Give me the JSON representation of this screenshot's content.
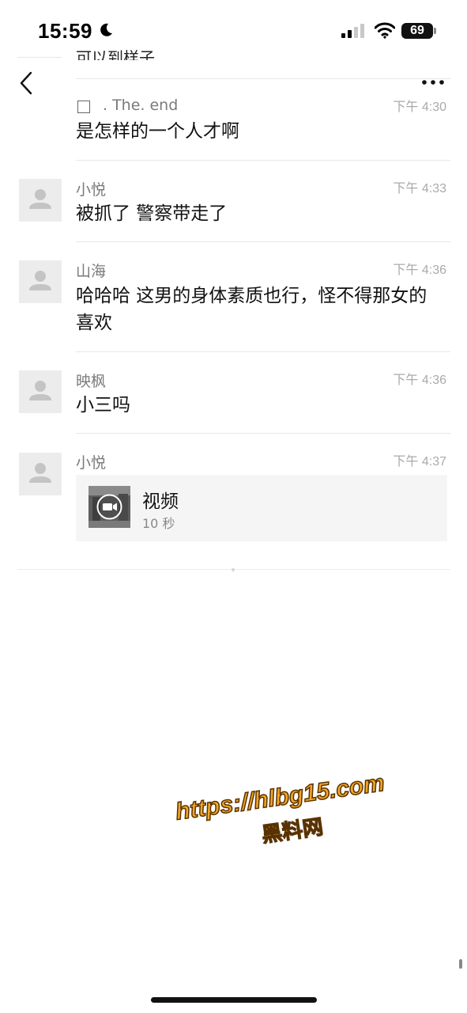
{
  "status_bar": {
    "time": "15:59",
    "battery": "69"
  },
  "previous_message_clip": "可以到样子",
  "messages": [
    {
      "sender": ". The. end",
      "time": "下午 4:30",
      "text": "是怎样的一个人才啊",
      "has_avatar": false
    },
    {
      "sender": "小悦",
      "time": "下午 4:33",
      "text": "被抓了 警察带走了",
      "has_avatar": true
    },
    {
      "sender": "山海",
      "time": "下午 4:36",
      "text": "哈哈哈 这男的身体素质也行，怪不得那女的喜欢",
      "has_avatar": true
    },
    {
      "sender": "映枫",
      "time": "下午 4:36",
      "text": "小三吗",
      "has_avatar": true
    },
    {
      "sender": "小悦",
      "time": "下午 4:37",
      "video": {
        "title": "视频",
        "duration": "10 秒"
      },
      "has_avatar": true
    }
  ],
  "watermark": {
    "url": "https://hlbg15.com",
    "name": "黑料网"
  },
  "colors": {
    "watermark_fill": "#f5a623",
    "timestamp": "#aaaaaa",
    "sender": "#7a7a7a"
  },
  "icons": {
    "back": "chevron-left-icon",
    "more": "more-dots-icon",
    "wifi": "wifi-icon",
    "signal": "signal-icon",
    "moon": "moon-icon",
    "video": "video-camera-icon"
  }
}
